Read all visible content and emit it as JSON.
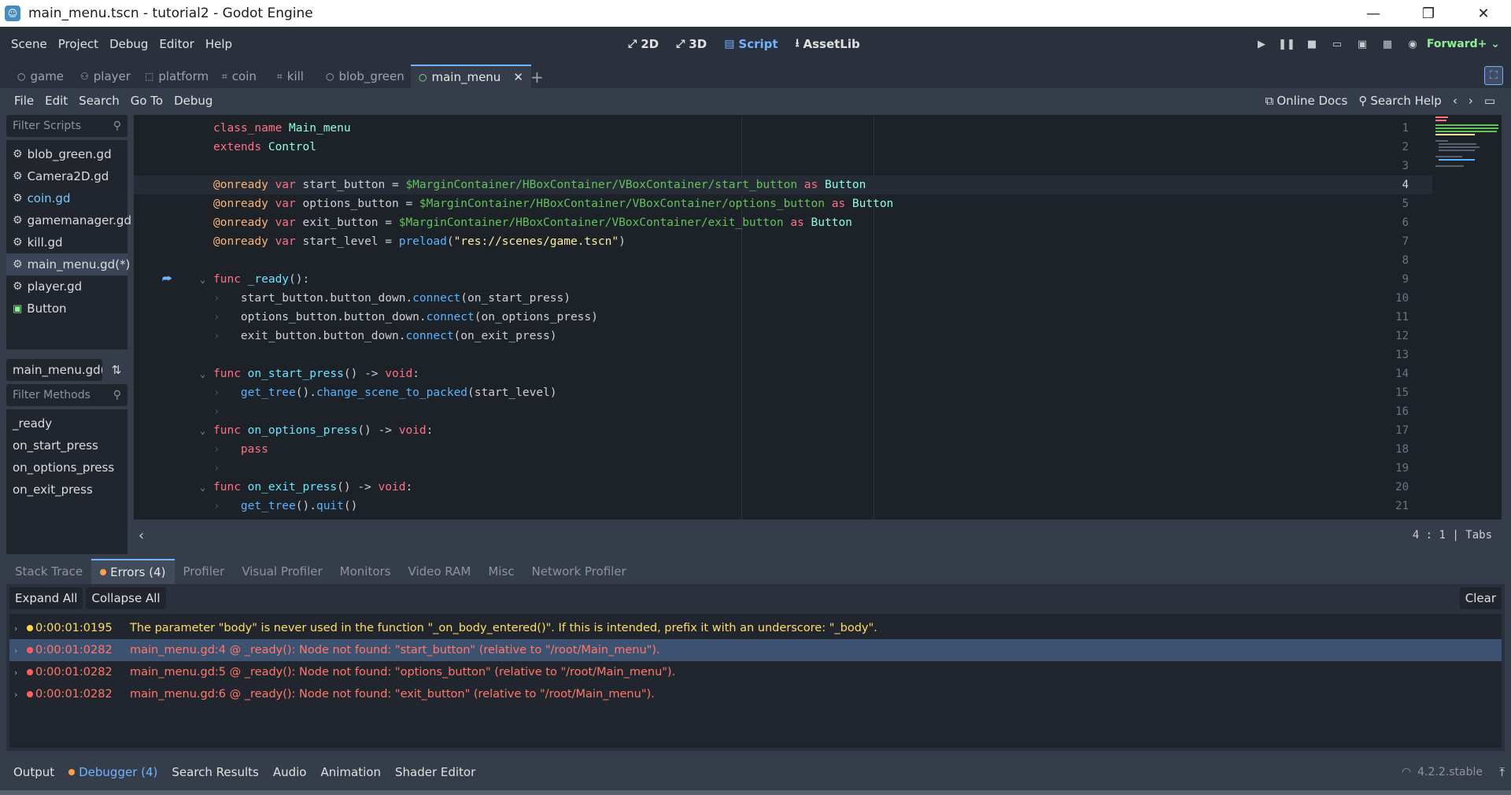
{
  "window": {
    "title": "main_menu.tscn - tutorial2 - Godot Engine",
    "controls": {
      "minimize": "—",
      "restore": "❐",
      "close": "✕"
    }
  },
  "menu": [
    "Scene",
    "Project",
    "Debug",
    "Editor",
    "Help"
  ],
  "main_screens": [
    {
      "label": "2D",
      "icon": "2d-icon"
    },
    {
      "label": "3D",
      "icon": "3d-icon"
    },
    {
      "label": "Script",
      "icon": "script-icon",
      "active": true
    },
    {
      "label": "AssetLib",
      "icon": "assetlib-icon"
    }
  ],
  "renderer": "Forward+",
  "scene_tabs": [
    {
      "label": "game",
      "icon": "node-icon"
    },
    {
      "label": "player",
      "icon": "character-icon"
    },
    {
      "label": "platform",
      "icon": "static-body-icon"
    },
    {
      "label": "coin",
      "icon": "area-icon"
    },
    {
      "label": "kill",
      "icon": "area-icon"
    },
    {
      "label": "blob_green",
      "icon": "node-icon"
    },
    {
      "label": "main_menu",
      "icon": "control-icon",
      "active": true
    }
  ],
  "script_menu": [
    "File",
    "Edit",
    "Search",
    "Go To",
    "Debug"
  ],
  "script_menu_right": {
    "online_docs": "Online Docs",
    "search_help": "Search Help"
  },
  "left_panel": {
    "filter_scripts_placeholder": "Filter Scripts",
    "scripts": [
      "blob_green.gd",
      "Camera2D.gd",
      "coin.gd",
      "gamemanager.gd",
      "kill.gd",
      "main_menu.gd(*)",
      "player.gd",
      "Button"
    ],
    "current_file": "main_menu.gd(*",
    "filter_methods_placeholder": "Filter Methods",
    "methods": [
      "_ready",
      "on_start_press",
      "on_options_press",
      "on_exit_press"
    ]
  },
  "editor": {
    "line_numbers": [
      "1",
      "2",
      "3",
      "4",
      "5",
      "6",
      "7",
      "8",
      "9",
      "10",
      "11",
      "12",
      "13",
      "14",
      "15",
      "16",
      "17",
      "18",
      "19",
      "20",
      "21"
    ],
    "current_line": 4,
    "cursor": "4 :    1",
    "indent": "Tabs"
  },
  "debugger": {
    "tabs": [
      "Stack Trace",
      "Errors (4)",
      "Profiler",
      "Visual Profiler",
      "Monitors",
      "Video RAM",
      "Misc",
      "Network Profiler"
    ],
    "expand_all": "Expand All",
    "collapse_all": "Collapse All",
    "clear": "Clear",
    "errors": [
      {
        "level": "warning",
        "time": "0:00:01:0195",
        "message": "The parameter \"body\" is never used in the function \"_on_body_entered()\". If this is intended, prefix it with an underscore: \"_body\"."
      },
      {
        "level": "error",
        "time": "0:00:01:0282",
        "message": "main_menu.gd:4 @ _ready(): Node not found: \"start_button\" (relative to \"/root/Main_menu\")."
      },
      {
        "level": "error",
        "time": "0:00:01:0282",
        "message": "main_menu.gd:5 @ _ready(): Node not found: \"options_button\" (relative to \"/root/Main_menu\")."
      },
      {
        "level": "error",
        "time": "0:00:01:0282",
        "message": "main_menu.gd:6 @ _ready(): Node not found: \"exit_button\" (relative to \"/root/Main_menu\")."
      }
    ]
  },
  "bottom_panel": [
    "Output",
    "Debugger (4)",
    "Search Results",
    "Audio",
    "Animation",
    "Shader Editor"
  ],
  "version": "4.2.2.stable",
  "code": {
    "l1a": "class_name",
    "l1b": " Main_menu",
    "l2a": "extends",
    "l2b": " Control",
    "l4a": "@onready",
    "l4b": " var",
    "l4c": " start_button = ",
    "l4d": "$MarginContainer/HBoxContainer/VBoxContainer/start_button",
    "l4e": " as",
    "l4f": " Button",
    "l5a": "@onready",
    "l5b": " var",
    "l5c": " options_button = ",
    "l5d": "$MarginContainer/HBoxContainer/VBoxContainer/options_button",
    "l5e": " as",
    "l5f": " Button",
    "l6a": "@onready",
    "l6b": " var",
    "l6c": " exit_button = ",
    "l6d": "$MarginContainer/HBoxContainer/VBoxContainer/exit_button",
    "l6e": " as",
    "l6f": " Button",
    "l7a": "@onready",
    "l7b": " var",
    "l7c": " start_level = ",
    "l7d": "preload",
    "l7e": "(",
    "l7f": "\"res://scenes/game.tscn\"",
    "l7g": ")",
    "l9a": "func",
    "l9b": " _ready",
    "l9c": "():",
    "l10a": "start_button.button_down.",
    "l10b": "connect",
    "l10c": "(on_start_press)",
    "l11a": "options_button.button_down.",
    "l11b": "connect",
    "l11c": "(on_options_press)",
    "l12a": "exit_button.button_down.",
    "l12b": "connect",
    "l12c": "(on_exit_press)",
    "l14a": "func",
    "l14b": " on_start_press",
    "l14c": "() -> ",
    "l14d": "void",
    "l14e": ":",
    "l15a": "get_tree",
    "l15b": "().",
    "l15c": "change_scene_to_packed",
    "l15d": "(start_level)",
    "l17a": "func",
    "l17b": " on_options_press",
    "l17c": "() -> ",
    "l17d": "void",
    "l17e": ":",
    "l18a": "pass",
    "l20a": "func",
    "l20b": " on_exit_press",
    "l20c": "() -> ",
    "l20d": "void",
    "l20e": ":",
    "l21a": "get_tree",
    "l21b": "().",
    "l21c": "quit",
    "l21d": "()"
  }
}
